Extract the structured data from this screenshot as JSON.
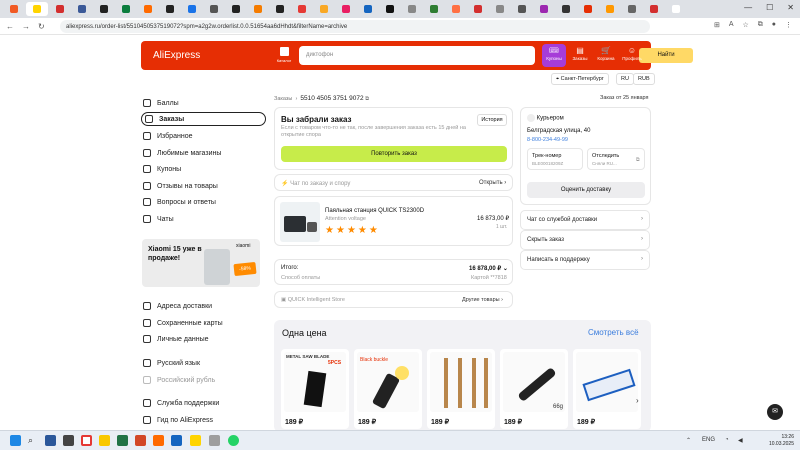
{
  "browser": {
    "url": "aliexpress.ru/order-list/5510450537519072?spm=a2g2w.orderlist.0.0.51654aa6dHhdt&filterName=archive",
    "tabs": [
      "",
      "",
      "",
      "",
      "",
      "",
      "",
      "",
      "",
      "",
      "",
      "",
      "",
      "",
      "",
      "",
      "",
      "",
      "",
      "",
      "",
      "",
      "",
      "",
      "",
      "",
      "",
      "",
      "",
      "",
      ""
    ],
    "tab_colors": [
      "#f15a24",
      "#ffd400",
      "#d32f2f",
      "#3b5998",
      "#222",
      "#0b7d3e",
      "#ff6a00",
      "#222",
      "#1a73e8",
      "#555",
      "#222",
      "#f57c00",
      "#222",
      "#e53935",
      "#f9a825",
      "#e91e63",
      "#1565c0",
      "#111",
      "#888",
      "#2e7d32",
      "#ff7043",
      "#d32f2f",
      "#888",
      "#555",
      "#9c27b0",
      "#333",
      "#e62e04",
      "#ff9800",
      "#666",
      "#d32f2f",
      "#fff"
    ]
  },
  "header": {
    "logo": "AliExpress",
    "catalog": "Каталог",
    "search_placeholder": "диктофон",
    "search_button": "Найти",
    "icons": [
      {
        "label": "Купоны",
        "badge": "0"
      },
      {
        "label": "Заказы"
      },
      {
        "label": "Корзина"
      },
      {
        "label": "Профиль"
      }
    ],
    "city": "Санкт-Петербург",
    "lang": "RU",
    "currency": "RUB"
  },
  "sidebar": {
    "items": [
      "Баллы",
      "Заказы",
      "Избранное",
      "Любимые магазины",
      "Купоны",
      "Отзывы на товары",
      "Вопросы и ответы",
      "Чаты"
    ],
    "promo_title": "Xiaomi 15 уже в продаже!",
    "promo_brand": "xiaomi",
    "promo_sale": "-58%",
    "items2": [
      "Адреса доставки",
      "Сохраненные карты",
      "Личные данные"
    ],
    "lang": "Русский язык",
    "currency": "Российский рубль",
    "help": [
      "Служба поддержки",
      "Гид по AliExpress"
    ]
  },
  "order": {
    "breadcrumb_root": "Заказы",
    "order_number": "5510 4505 3751 9072",
    "date": "Заказ от 25 января",
    "status_title": "Вы забрали заказ",
    "status_text": "Если с товаром что-то не так, после завершения заказа есть 15 дней на открытие спора",
    "history": "История",
    "repeat": "Повторить заказ",
    "chat_label": "Чат по заказу и спору",
    "chat_link": "Открыть",
    "product_title": "Паяльная станция QUICK TS2300D",
    "product_option": "Attention voltage",
    "price": "16 873,00 ₽",
    "qty": "1 шт.",
    "rating": 5,
    "total_label": "Итого:",
    "total": "16 878,00 ₽",
    "payment_label": "Способ оплаты",
    "payment_value": "Картой **7818",
    "store": "QUICK Intelligent Store",
    "store_link": "Другие товары"
  },
  "delivery": {
    "courier": "Курьером",
    "address": "Белградская улица, 40",
    "phone": "8-800-234-49-99",
    "track_label": "Трек-номер",
    "track_value": "BLE00018209Z",
    "follow_label": "Отследить",
    "follow_value": "Сняли RU...",
    "rate": "Оценить доставку",
    "links": [
      "Чат со службой доставки",
      "Скрыть заказ",
      "Написать в поддержку"
    ]
  },
  "one_price": {
    "title": "Одна цена",
    "see_all": "Смотреть всё",
    "products": [
      {
        "price": "189 ₽",
        "tag": "METAL SAW BLADE",
        "badge": "5PCS"
      },
      {
        "price": "189 ₽",
        "tag": "Black buckle"
      },
      {
        "price": "189 ₽",
        "tag": ""
      },
      {
        "price": "189 ₽",
        "tag": "66g"
      },
      {
        "price": "189 ₽",
        "tag": ""
      }
    ]
  },
  "taskbar": {
    "time": "13:26",
    "date": "10.03.2025"
  },
  "colors": {
    "brand": "#e62e04",
    "accent_green": "#c7ec4a",
    "accent_purple": "#a63cd8"
  }
}
